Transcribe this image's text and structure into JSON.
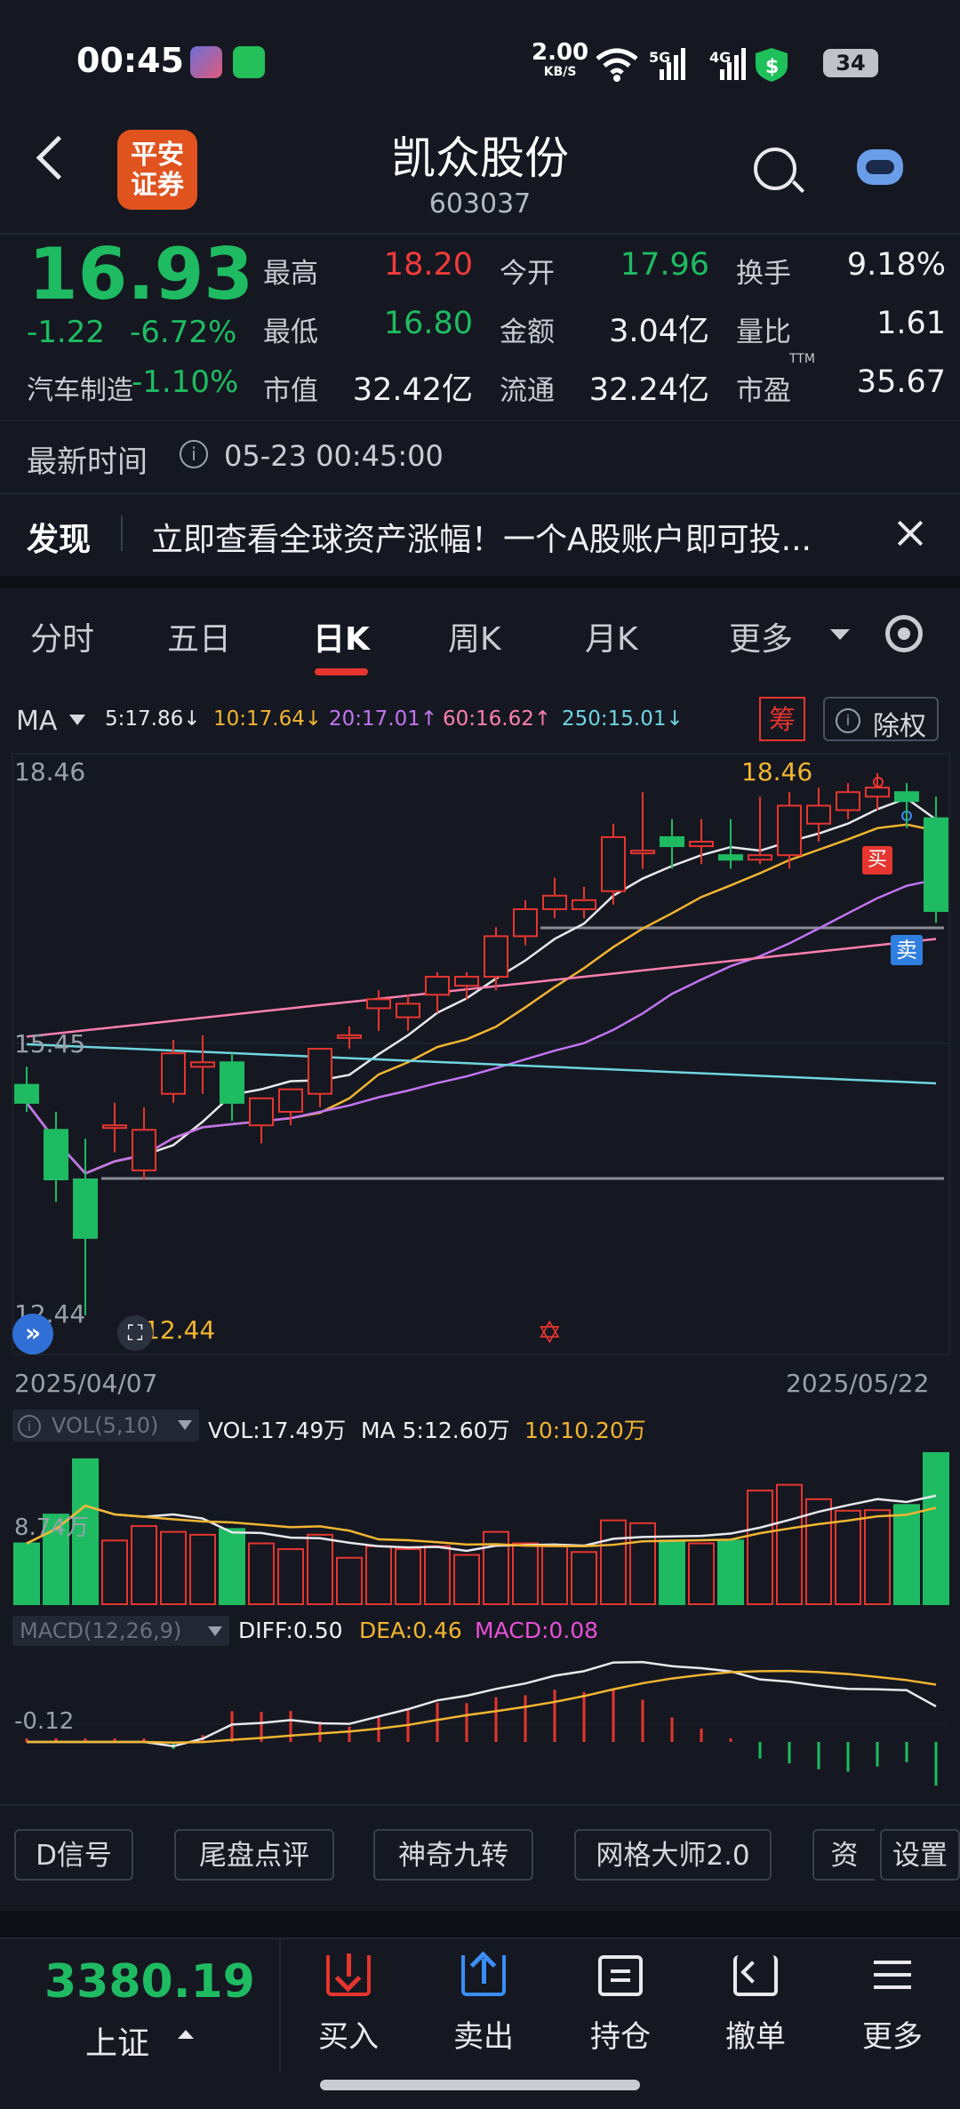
{
  "status_bar": {
    "time": "00:45",
    "speed": "2.00",
    "speed_unit": "KB/S",
    "net1": "5G",
    "net2": "4G",
    "battery": "34"
  },
  "header": {
    "broker_logo": "平安\n证券",
    "stock_name": "凯众股份",
    "stock_code": "603037"
  },
  "quote": {
    "price": "16.93",
    "change": "-1.22",
    "change_pct": "-6.72%",
    "sector_label": "汽车制造",
    "sector_change": "-1.10%",
    "fields": [
      {
        "label": "最高",
        "value": "18.20",
        "color": "#f23a3a"
      },
      {
        "label": "今开",
        "value": "17.96",
        "color": "#1fbb62"
      },
      {
        "label": "换手",
        "value": "9.18%",
        "color": "#f1f1f5"
      },
      {
        "label": "最低",
        "value": "16.80",
        "color": "#1fbb62"
      },
      {
        "label": "金额",
        "value": "3.04亿",
        "color": "#f1f1f5"
      },
      {
        "label": "量比",
        "value": "1.61",
        "color": "#f1f1f5"
      },
      {
        "label": "市值",
        "value": "32.42亿",
        "color": "#f1f1f5"
      },
      {
        "label": "流通",
        "value": "32.24亿",
        "color": "#f1f1f5"
      },
      {
        "label": "市盈",
        "value": "35.67",
        "color": "#f1f1f5"
      }
    ],
    "ttm": "TTM",
    "update_label": "最新时间",
    "update_time": "05-23 00:45:00"
  },
  "discover": {
    "label": "发现",
    "text": "立即查看全球资产涨幅！一个A股账户即可投..."
  },
  "tabs": [
    {
      "label": "分时",
      "active": false
    },
    {
      "label": "五日",
      "active": false
    },
    {
      "label": "日K",
      "active": true
    },
    {
      "label": "周K",
      "active": false
    },
    {
      "label": "月K",
      "active": false
    },
    {
      "label": "更多",
      "active": false
    }
  ],
  "ma_bar": {
    "label": "MA",
    "values": [
      {
        "text": "5:17.86↓",
        "color": "#e8e8ee"
      },
      {
        "text": "10:17.64↓",
        "color": "#f2b531"
      },
      {
        "text": "20:17.01↑",
        "color": "#c174f0"
      },
      {
        "text": "60:16.62↑",
        "color": "#ff7fb0"
      },
      {
        "text": "250:15.01↓",
        "color": "#6fd5e0"
      }
    ],
    "chip_button": "筹",
    "ex_right_button": "除权"
  },
  "kline": {
    "high_label": "18.46",
    "mid_label": "15.45",
    "low_label": "12.44",
    "max_marker": "18.46",
    "min_marker": "12.44",
    "buy_marker": "买",
    "sell_marker": "卖",
    "start_date": "2025/04/07",
    "end_date": "2025/05/22"
  },
  "chart_data": [
    {
      "type": "candlestick",
      "x": [
        "2025/04/07",
        "2025/05/22"
      ],
      "y_ticks": [
        18.46,
        15.45,
        12.44
      ],
      "ylim": [
        12.44,
        18.46
      ],
      "series": [
        {
          "name": "MA5",
          "last": 17.86
        },
        {
          "name": "MA10",
          "last": 17.64
        },
        {
          "name": "MA20",
          "last": 17.01
        },
        {
          "name": "MA60",
          "last": 16.62
        },
        {
          "name": "MA250",
          "last": 15.01
        }
      ],
      "candles_ohlc": [
        [
          15.0,
          15.2,
          14.7,
          14.8
        ],
        [
          14.5,
          14.7,
          13.7,
          13.95
        ],
        [
          13.95,
          14.4,
          12.44,
          13.3
        ],
        [
          14.55,
          14.8,
          14.25,
          14.55
        ],
        [
          14.05,
          14.75,
          13.95,
          14.5
        ],
        [
          14.9,
          15.5,
          14.8,
          15.35
        ],
        [
          15.2,
          15.55,
          14.9,
          15.25
        ],
        [
          15.25,
          15.35,
          14.6,
          14.8
        ],
        [
          14.55,
          14.85,
          14.35,
          14.85
        ],
        [
          14.7,
          14.95,
          14.55,
          14.95
        ],
        [
          14.9,
          15.4,
          14.75,
          15.4
        ],
        [
          15.55,
          15.65,
          15.4,
          15.55
        ],
        [
          15.85,
          16.05,
          15.6,
          15.95
        ],
        [
          15.75,
          16.0,
          15.6,
          15.9
        ],
        [
          16.0,
          16.25,
          15.8,
          16.2
        ],
        [
          16.1,
          16.25,
          15.95,
          16.2
        ],
        [
          16.2,
          16.75,
          16.05,
          16.65
        ],
        [
          16.65,
          17.05,
          16.55,
          16.95
        ],
        [
          16.95,
          17.3,
          16.85,
          17.1
        ],
        [
          16.95,
          17.2,
          16.85,
          17.05
        ],
        [
          17.15,
          17.9,
          17.0,
          17.75
        ],
        [
          17.6,
          18.25,
          17.4,
          17.6
        ],
        [
          17.75,
          17.95,
          17.4,
          17.65
        ],
        [
          17.65,
          17.95,
          17.45,
          17.7
        ],
        [
          17.55,
          17.95,
          17.4,
          17.5
        ],
        [
          17.5,
          18.2,
          17.45,
          17.55
        ],
        [
          17.55,
          18.25,
          17.4,
          18.1
        ],
        [
          17.9,
          18.3,
          17.7,
          18.1
        ],
        [
          18.05,
          18.35,
          17.95,
          18.25
        ],
        [
          18.2,
          18.46,
          18.05,
          18.3
        ],
        [
          18.25,
          18.35,
          17.85,
          18.15
        ],
        [
          17.96,
          18.2,
          16.8,
          16.93
        ]
      ]
    },
    {
      "type": "bar",
      "name": "VOL(5,10)",
      "y_tick": "8.74万",
      "latest": {
        "VOL": "17.49万",
        "MA5": "12.60万",
        "MA10": "10.20万"
      }
    },
    {
      "type": "bar",
      "name": "MACD(12,26,9)",
      "y_tick": "-0.12",
      "latest": {
        "DIFF": "0.50",
        "DEA": "0.46",
        "MACD": "0.08"
      }
    }
  ],
  "vol_bar": {
    "label": "VOL(5,10)",
    "vol": "VOL:17.49万",
    "ma5": "MA 5:12.60万",
    "ma10": "10:10.20万",
    "tick": "8.74万"
  },
  "macd_bar": {
    "label": "MACD(12,26,9)",
    "diff": "DIFF:0.50",
    "dea": "DEA:0.46",
    "macd": "MACD:0.08",
    "tick": "-0.12"
  },
  "feature_buttons": [
    "D信号",
    "尾盘点评",
    "神奇九转",
    "网格大师2.0",
    "资",
    "设置"
  ],
  "bottom_bar": {
    "index_value": "3380.19",
    "index_name": "上证",
    "actions": [
      {
        "label": "买入",
        "icon": "buy-icon",
        "color": "#e6352f"
      },
      {
        "label": "卖出",
        "icon": "sell-icon",
        "color": "#3a8ef5"
      },
      {
        "label": "持仓",
        "icon": "holdings-icon",
        "color": "#e8e8ee"
      },
      {
        "label": "撤单",
        "icon": "cancel-order-icon",
        "color": "#e8e8ee"
      },
      {
        "label": "更多",
        "icon": "more-icon",
        "color": "#e8e8ee"
      }
    ]
  }
}
